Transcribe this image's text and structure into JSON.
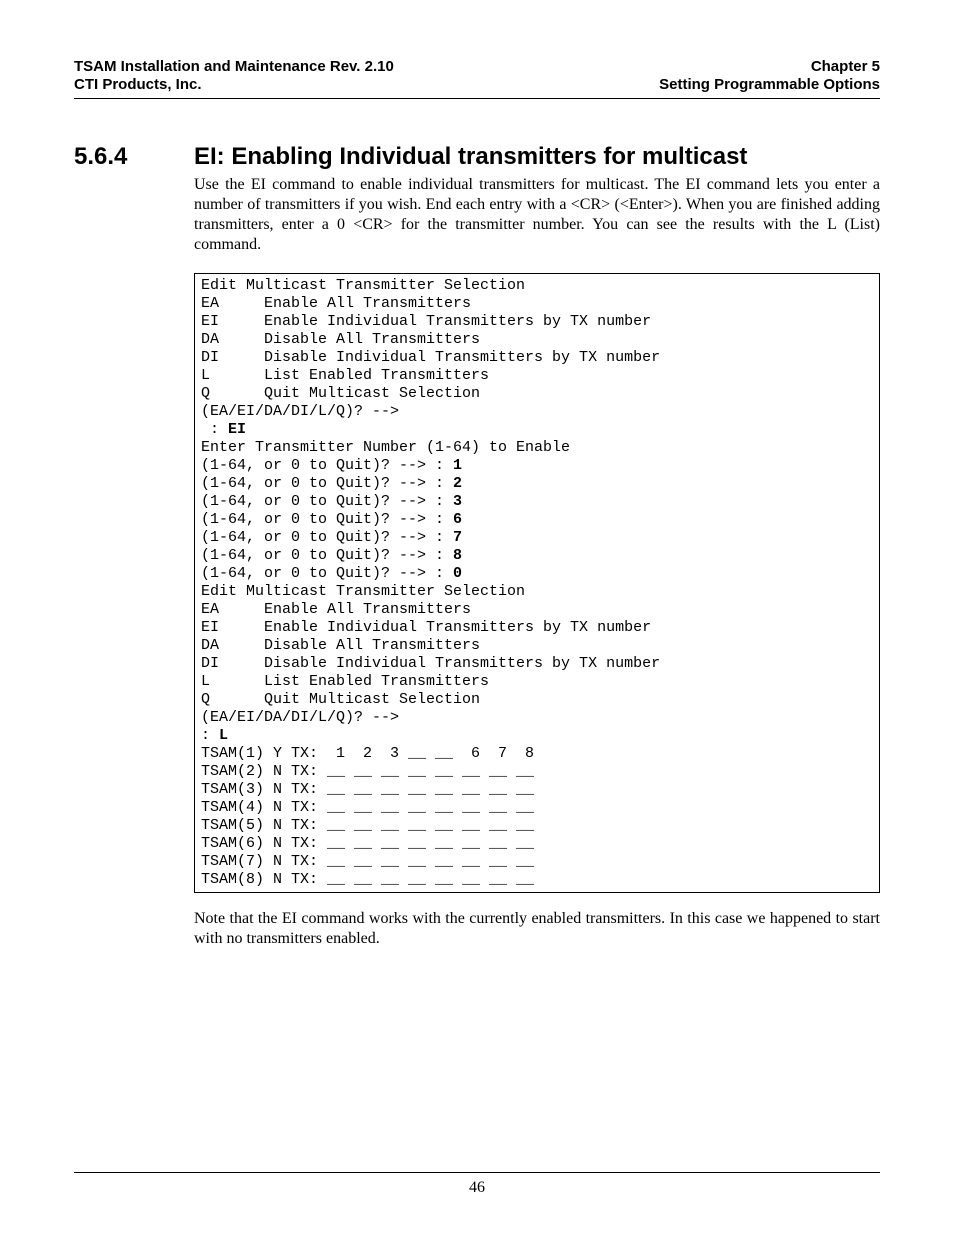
{
  "header": {
    "left1": "TSAM Installation and Maintenance Rev. 2.10",
    "left2": "CTI Products, Inc.",
    "right1": "Chapter 5",
    "right2": "Setting Programmable Options"
  },
  "section": {
    "number": "5.6.4",
    "title": "EI:  Enabling Individual transmitters for multicast"
  },
  "para1": "Use the EI command to enable individual transmitters for multicast.  The EI command lets you enter a number of transmitters if you wish.  End each entry with a <CR> (<Enter>).  When you are finished adding transmitters, enter a 0 <CR> for the transmitter number.  You can see the results with the L (List) command.",
  "code": {
    "line01": "Edit Multicast Transmitter Selection",
    "line02": "EA     Enable All Transmitters",
    "line03": "EI     Enable Individual Transmitters by TX number",
    "line04": "DA     Disable All Transmitters",
    "line05": "DI     Disable Individual Transmitters by TX number",
    "line06": "L      List Enabled Transmitters",
    "line07": "Q      Quit Multicast Selection",
    "line08": "(EA/EI/DA/DI/L/Q)? -->",
    "line09a": " : ",
    "line09b": "EI",
    "line10": "Enter Transmitter Number (1-64) to Enable",
    "line11a": "(1-64, or 0 to Quit)? --> : ",
    "line11b": "1",
    "line12a": "(1-64, or 0 to Quit)? --> : ",
    "line12b": "2",
    "line13a": "(1-64, or 0 to Quit)? --> : ",
    "line13b": "3",
    "line14a": "(1-64, or 0 to Quit)? --> : ",
    "line14b": "6",
    "line15a": "(1-64, or 0 to Quit)? --> : ",
    "line15b": "7",
    "line16a": "(1-64, or 0 to Quit)? --> : ",
    "line16b": "8",
    "line17a": "(1-64, or 0 to Quit)? --> : ",
    "line17b": "0",
    "line18": "Edit Multicast Transmitter Selection",
    "line19": "EA     Enable All Transmitters",
    "line20": "EI     Enable Individual Transmitters by TX number",
    "line21": "DA     Disable All Transmitters",
    "line22": "DI     Disable Individual Transmitters by TX number",
    "line23": "L      List Enabled Transmitters",
    "line24": "Q      Quit Multicast Selection",
    "line25": "(EA/EI/DA/DI/L/Q)? -->",
    "line26a": ": ",
    "line26b": "L",
    "line27": "TSAM(1) Y TX:  1  2  3 __ __  6  7  8",
    "line28": "TSAM(2) N TX: __ __ __ __ __ __ __ __",
    "line29": "TSAM(3) N TX: __ __ __ __ __ __ __ __",
    "line30": "TSAM(4) N TX: __ __ __ __ __ __ __ __",
    "line31": "TSAM(5) N TX: __ __ __ __ __ __ __ __",
    "line32": "TSAM(6) N TX: __ __ __ __ __ __ __ __",
    "line33": "TSAM(7) N TX: __ __ __ __ __ __ __ __",
    "line34": "TSAM(8) N TX: __ __ __ __ __ __ __ __"
  },
  "note": "Note that the EI command works with the currently enabled transmitters.  In this case we happened to start with no transmitters enabled.",
  "footer": {
    "page": "46"
  }
}
